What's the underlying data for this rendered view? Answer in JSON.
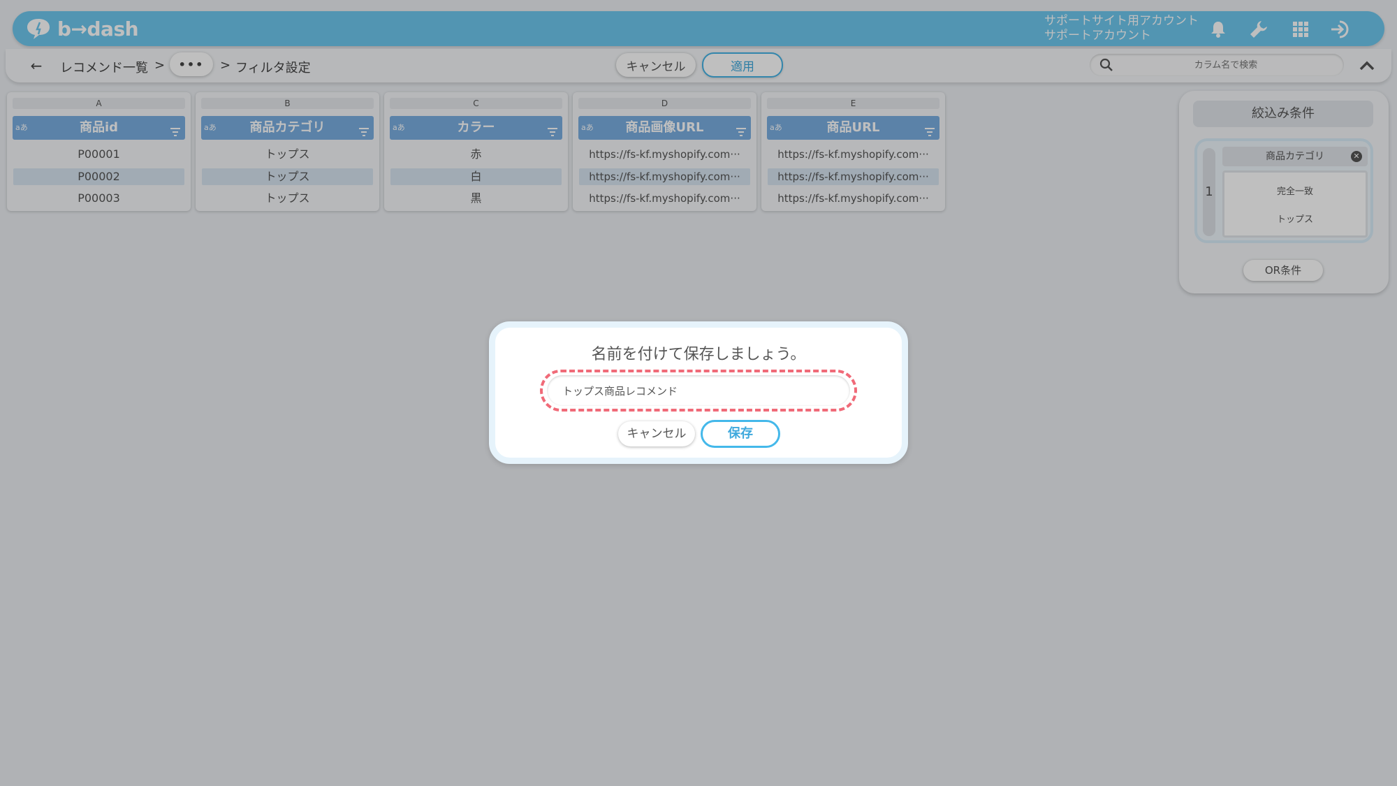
{
  "header": {
    "logo_text": "b→dash",
    "account_line1": "サポートサイト用アカウント",
    "account_line2": "サポートアカウント",
    "icons": [
      "bell-icon",
      "wrench-icon",
      "apps-grid-icon",
      "logout-icon"
    ]
  },
  "toolbar": {
    "breadcrumb_1": "レコメンド一覧",
    "separator": ">",
    "dots": "•••",
    "breadcrumb_current": "フィルタ設定",
    "cancel_label": "キャンセル",
    "apply_label": "適用",
    "search_placeholder": "カラム名で検索"
  },
  "columns": [
    {
      "letter": "A",
      "type": "aあ",
      "name": "商品id",
      "cells": [
        "P00001",
        "P00002",
        "P00003"
      ]
    },
    {
      "letter": "B",
      "type": "aあ",
      "name": "商品カテゴリ",
      "cells": [
        "トップス",
        "トップス",
        "トップス"
      ]
    },
    {
      "letter": "C",
      "type": "aあ",
      "name": "カラー",
      "cells": [
        "赤",
        "白",
        "黒"
      ]
    },
    {
      "letter": "D",
      "type": "aあ",
      "name": "商品画像URL",
      "cells": [
        "https://fs-kf.myshopify.com···",
        "https://fs-kf.myshopify.com···",
        "https://fs-kf.myshopify.com···"
      ]
    },
    {
      "letter": "E",
      "type": "aあ",
      "name": "商品URL",
      "cells": [
        "https://fs-kf.myshopify.com···",
        "https://fs-kf.myshopify.com···",
        "https://fs-kf.myshopify.com···"
      ]
    }
  ],
  "filter_panel": {
    "title": "絞込み条件",
    "group_number": "1",
    "condition_column": "商品カテゴリ",
    "condition_operator": "完全一致",
    "condition_value": "トップス",
    "or_label": "OR条件"
  },
  "modal": {
    "title": "名前を付けて保存しましょう。",
    "name_value": "トップス商品レコメンド",
    "cancel_label": "キャンセル",
    "save_label": "保存"
  },
  "colors": {
    "header_bg": "#6ec7ee",
    "column_header_bg": "#7aaee0",
    "accent": "#44b3e6",
    "highlight_dash": "#f06a78"
  }
}
